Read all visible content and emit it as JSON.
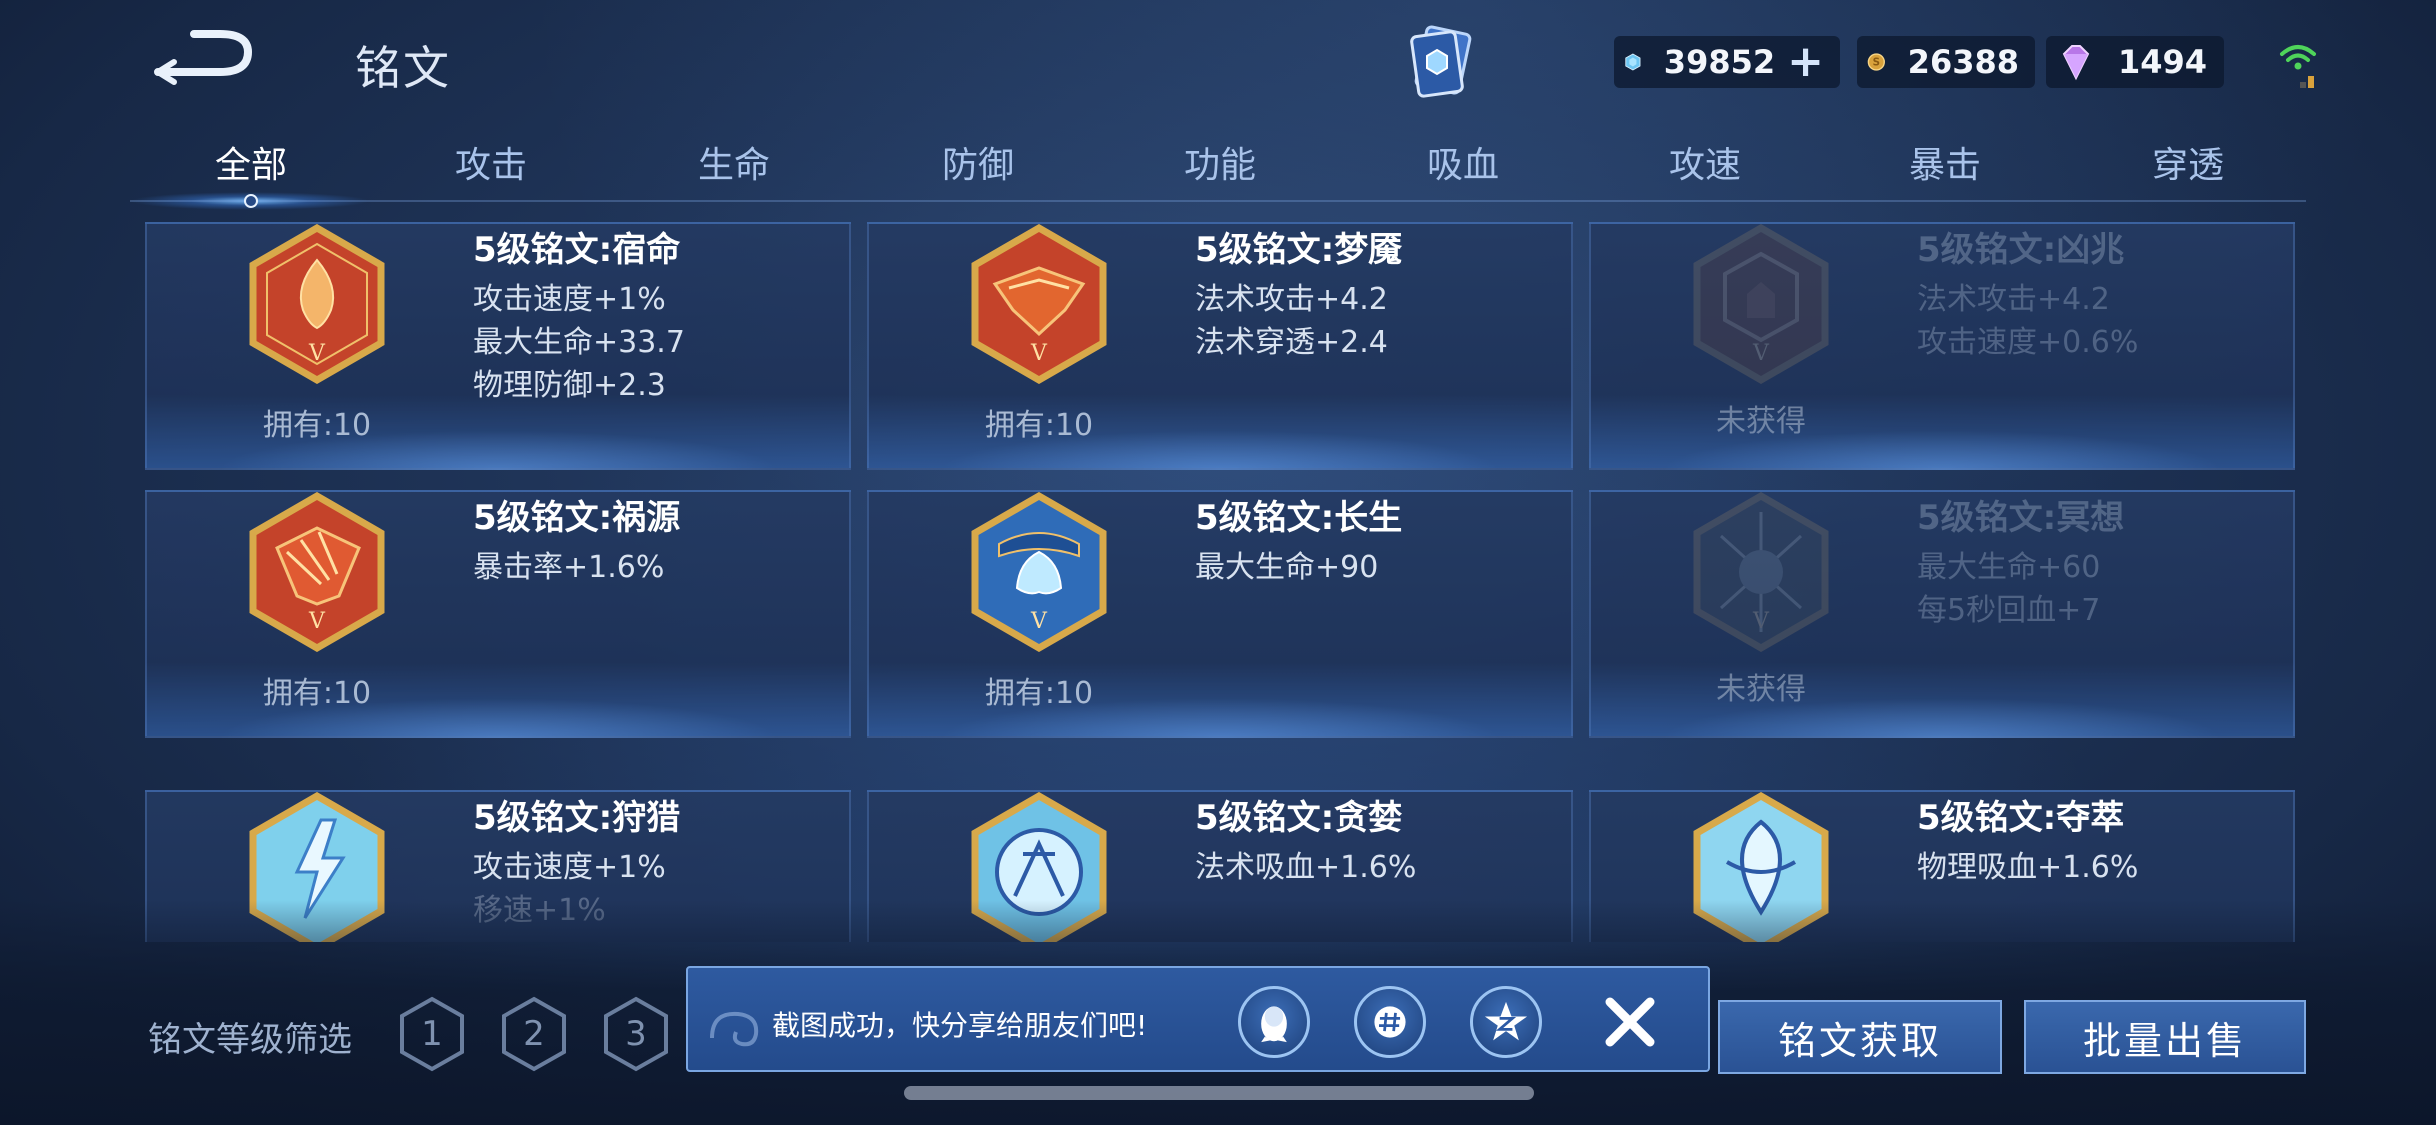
{
  "header": {
    "title": "铭文",
    "currencies": [
      {
        "icon": "diamond-icon",
        "amount": "39852",
        "add": "+"
      },
      {
        "icon": "gold-coin-icon",
        "amount": "26388"
      },
      {
        "icon": "gem-icon",
        "amount": "1494"
      }
    ]
  },
  "tabs": [
    {
      "label": "全部",
      "active": true
    },
    {
      "label": "攻击"
    },
    {
      "label": "生命"
    },
    {
      "label": "防御"
    },
    {
      "label": "功能"
    },
    {
      "label": "吸血"
    },
    {
      "label": "攻速"
    },
    {
      "label": "暴击"
    },
    {
      "label": "穿透"
    }
  ],
  "cards": [
    {
      "name": "5级铭文:宿命",
      "attrs": [
        "攻击速度+1%",
        "最大生命+33.7",
        "物理防御+2.3"
      ],
      "owned": "拥有:10",
      "color": "red"
    },
    {
      "name": "5级铭文:梦魇",
      "attrs": [
        "法术攻击+4.2",
        "法术穿透+2.4"
      ],
      "owned": "拥有:10",
      "color": "red"
    },
    {
      "name": "5级铭文:凶兆",
      "attrs": [
        "法术攻击+4.2",
        "攻击速度+0.6%"
      ],
      "owned": "未获得",
      "color": "red",
      "locked": true
    },
    {
      "name": "5级铭文:祸源",
      "attrs": [
        "暴击率+1.6%"
      ],
      "owned": "拥有:10",
      "color": "red"
    },
    {
      "name": "5级铭文:长生",
      "attrs": [
        "最大生命+90"
      ],
      "owned": "拥有:10",
      "color": "blue"
    },
    {
      "name": "5级铭文:冥想",
      "attrs": [
        "最大生命+60",
        "每5秒回血+7"
      ],
      "owned": "未获得",
      "color": "blue",
      "locked": true
    },
    {
      "name": "5级铭文:狩猎",
      "attrs": [
        "攻击速度+1%",
        "移速+1%"
      ],
      "color": "cyan"
    },
    {
      "name": "5级铭文:贪婪",
      "attrs": [
        "法术吸血+1.6%"
      ],
      "color": "cyan"
    },
    {
      "name": "5级铭文:夺萃",
      "attrs": [
        "物理吸血+1.6%"
      ],
      "color": "cyan"
    }
  ],
  "bottom": {
    "filter_label": "铭文等级筛选",
    "levels": [
      "1",
      "2",
      "3"
    ],
    "toast": "截图成功，快分享给朋友们吧!",
    "obtain_button": "铭文获取",
    "sell_button": "批量出售"
  },
  "colors": {
    "background": "#1f3458",
    "button": "#3a68ad",
    "toast": "#2e5aa0",
    "emblem_red": "#c4432a",
    "emblem_blue": "#3c7fc8",
    "emblem_cyan": "#7fd0ec",
    "gold_frame": "#d8a94a"
  }
}
